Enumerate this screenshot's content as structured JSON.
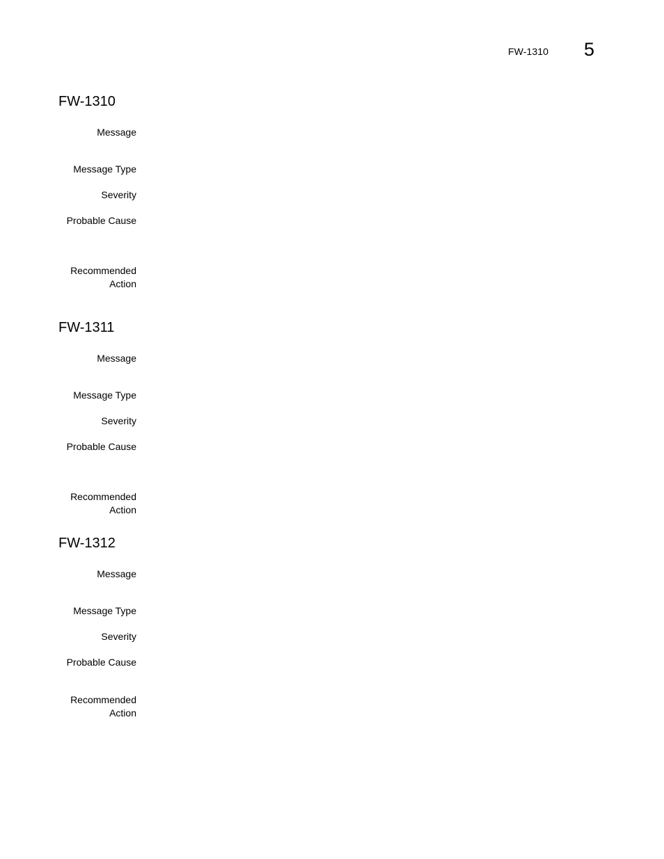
{
  "header": {
    "title": "FW-1310",
    "chapter_number": "5"
  },
  "sections": [
    {
      "title": "FW-1310",
      "fields": [
        {
          "label": "Message",
          "value": ""
        },
        {
          "label": "Message Type",
          "value": ""
        },
        {
          "label": "Severity",
          "value": ""
        },
        {
          "label": "Probable Cause",
          "value": ""
        },
        {
          "label_line1": "Recommended",
          "label_line2": "Action",
          "value": ""
        }
      ]
    },
    {
      "title": "FW-1311",
      "fields": [
        {
          "label": "Message",
          "value": ""
        },
        {
          "label": "Message Type",
          "value": ""
        },
        {
          "label": "Severity",
          "value": ""
        },
        {
          "label": "Probable Cause",
          "value": ""
        },
        {
          "label_line1": "Recommended",
          "label_line2": "Action",
          "value": ""
        }
      ]
    },
    {
      "title": "FW-1312",
      "fields": [
        {
          "label": "Message",
          "value": ""
        },
        {
          "label": "Message Type",
          "value": ""
        },
        {
          "label": "Severity",
          "value": ""
        },
        {
          "label": "Probable Cause",
          "value": ""
        },
        {
          "label_line1": "Recommended",
          "label_line2": "Action",
          "value": ""
        }
      ]
    }
  ]
}
